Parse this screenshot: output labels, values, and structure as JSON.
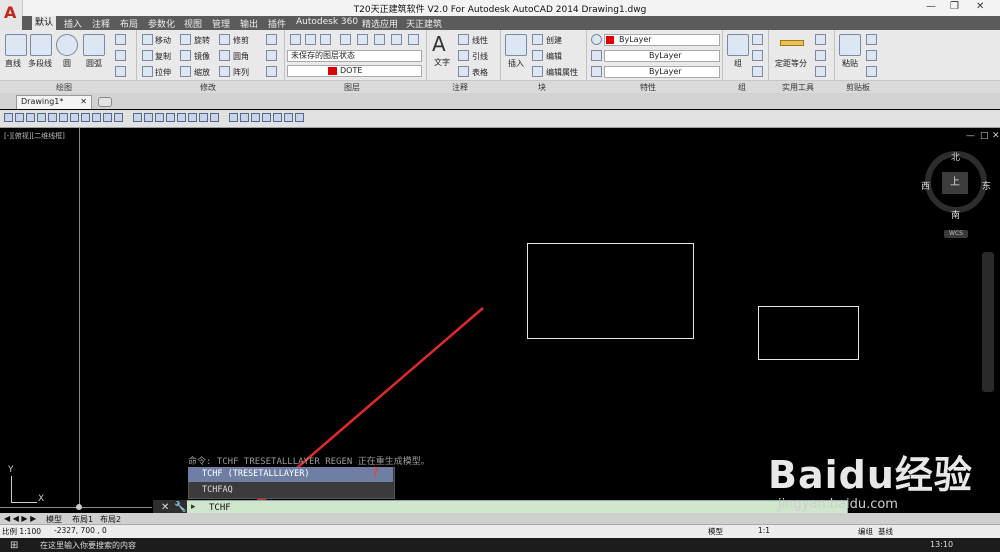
{
  "window": {
    "title": "T20天正建筑软件 V2.0 For Autodesk AutoCAD 2014    Drawing1.dwg"
  },
  "menu_tabs": [
    "默认",
    "插入",
    "注释",
    "布局",
    "参数化",
    "视图",
    "管理",
    "输出",
    "插件",
    "Autodesk 360",
    "精选应用",
    "天正建筑"
  ],
  "ribbon": {
    "draw": [
      "直线",
      "多段线",
      "圆",
      "圆弧"
    ],
    "modify": [
      "移动",
      "旋转",
      "修剪",
      "复制",
      "镜像",
      "圆角",
      "拉伸",
      "缩放",
      "阵列"
    ],
    "layer_state": "未保存的图层状态",
    "layer_current": "DOTE",
    "text_big": "文字",
    "annot_items": [
      "线性",
      "引线",
      "表格"
    ],
    "block_items": [
      "插入",
      "创建",
      "编辑",
      "编辑属性"
    ],
    "prop_color": "ByLayer",
    "prop_lineweight": "ByLayer",
    "prop_linetype": "ByLayer",
    "group_label": "组",
    "util_label": "定距等分",
    "clip_label": "粘贴",
    "panels": [
      "绘图",
      "修改",
      "图层",
      "注释",
      "块",
      "特性",
      "组",
      "实用工具",
      "剪贴板"
    ]
  },
  "doc_tab": "Drawing1*",
  "viewport_label": "[-][俯视][二维线框]",
  "viewcube": {
    "north": "北",
    "south": "南",
    "east": "东",
    "west": "西",
    "top": "上",
    "wcs": "WCS"
  },
  "command": {
    "history": "命令: TCHF TRESETALLLAYER REGEN 正在重生成模型。",
    "suggestions": [
      "TCHF (TRESETALLLAYER)",
      "TCHFAQ"
    ],
    "input": "TCHF"
  },
  "layout_tabs": [
    "模型",
    "布局1",
    "布局2"
  ],
  "status": {
    "coords": "-2327, 700 , 0",
    "left": "比例 1:100",
    "scale": "1:1",
    "model": "模型",
    "right_items": [
      "编组",
      "基线"
    ]
  },
  "taskbar": {
    "search": "在这里输入你要搜索的内容",
    "time": "13:10"
  },
  "watermark": {
    "brand": "Baidu经验",
    "url": "jingyan.baidu.com"
  },
  "colors": {
    "ribbon_bg": "#e9e9e9",
    "menu_bg": "#5b5b5b",
    "canvas_bg": "#000000",
    "cmd_bg": "#cfe6cc",
    "suggest_hl": "#6f7fa4",
    "arrow": "#e02a2a"
  }
}
